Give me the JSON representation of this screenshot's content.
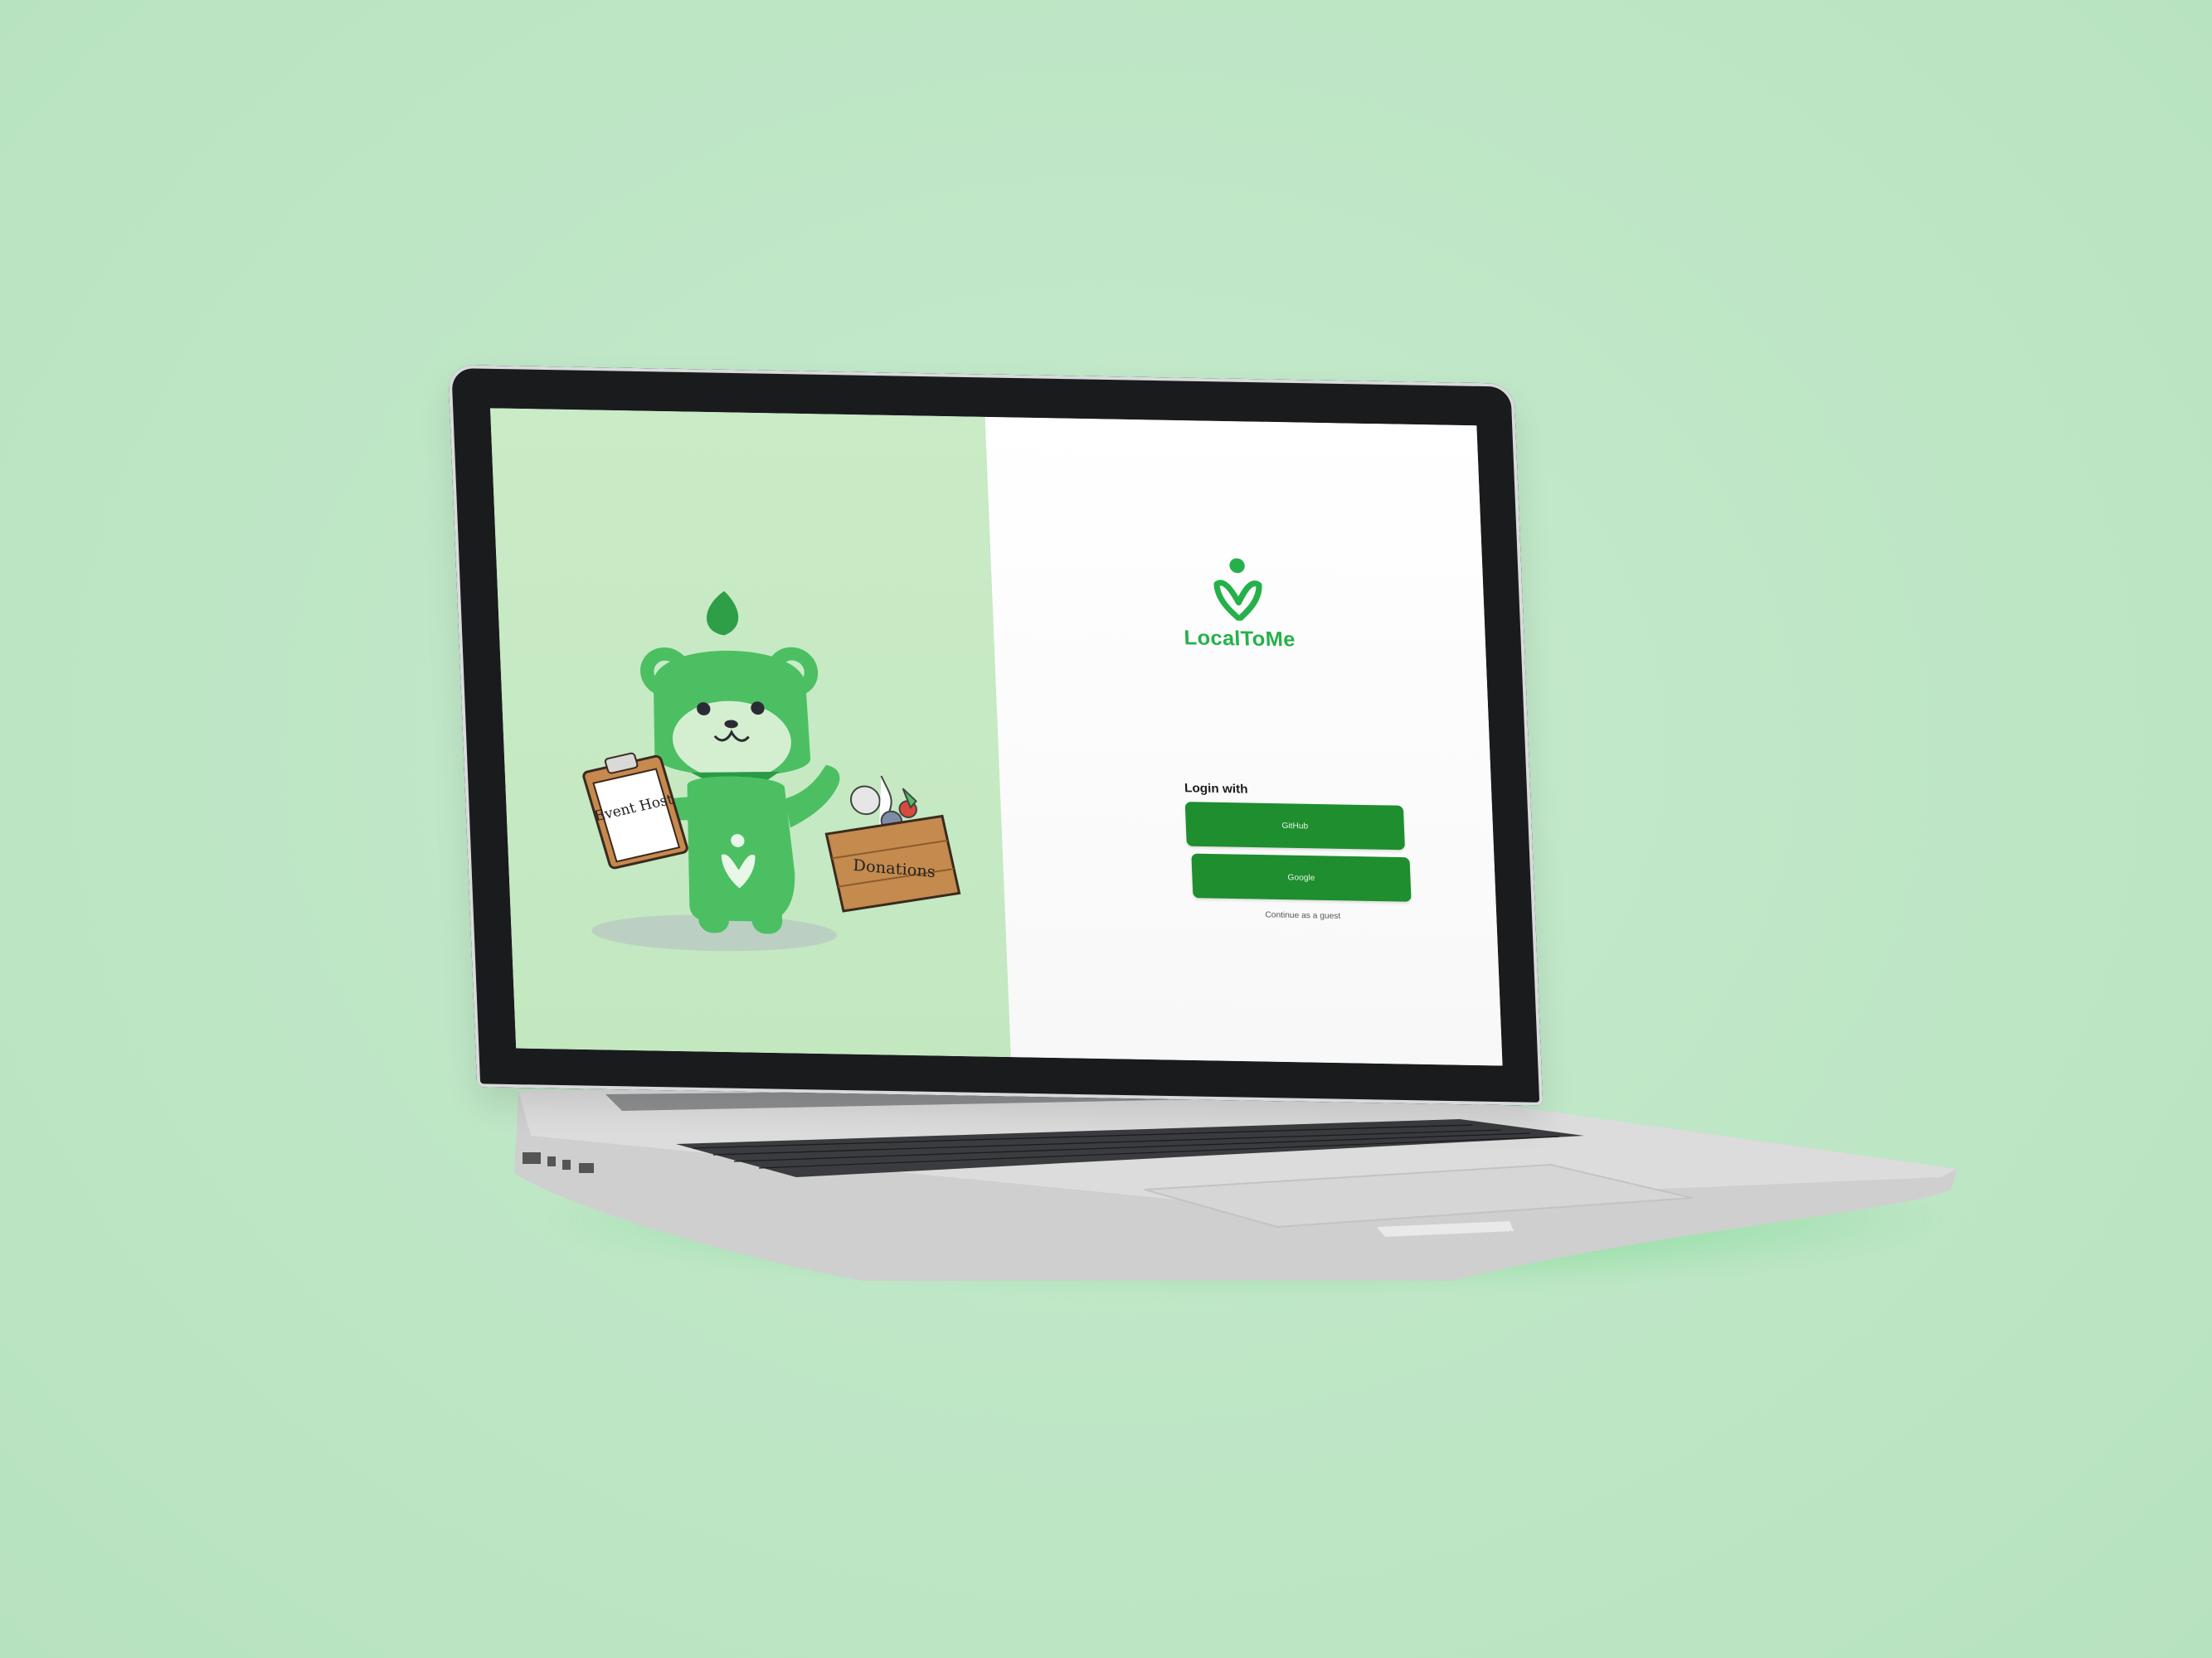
{
  "app": {
    "brand_name": "LocalToMe",
    "brand_color": "#25b14a",
    "button_color": "#1e8e2e"
  },
  "illustration": {
    "clipboard_text": "Event Host",
    "box_text": "Donations"
  },
  "login": {
    "label": "Login with",
    "github_button": "GitHub",
    "google_button": "Google",
    "guest_link": "Continue as a guest"
  }
}
